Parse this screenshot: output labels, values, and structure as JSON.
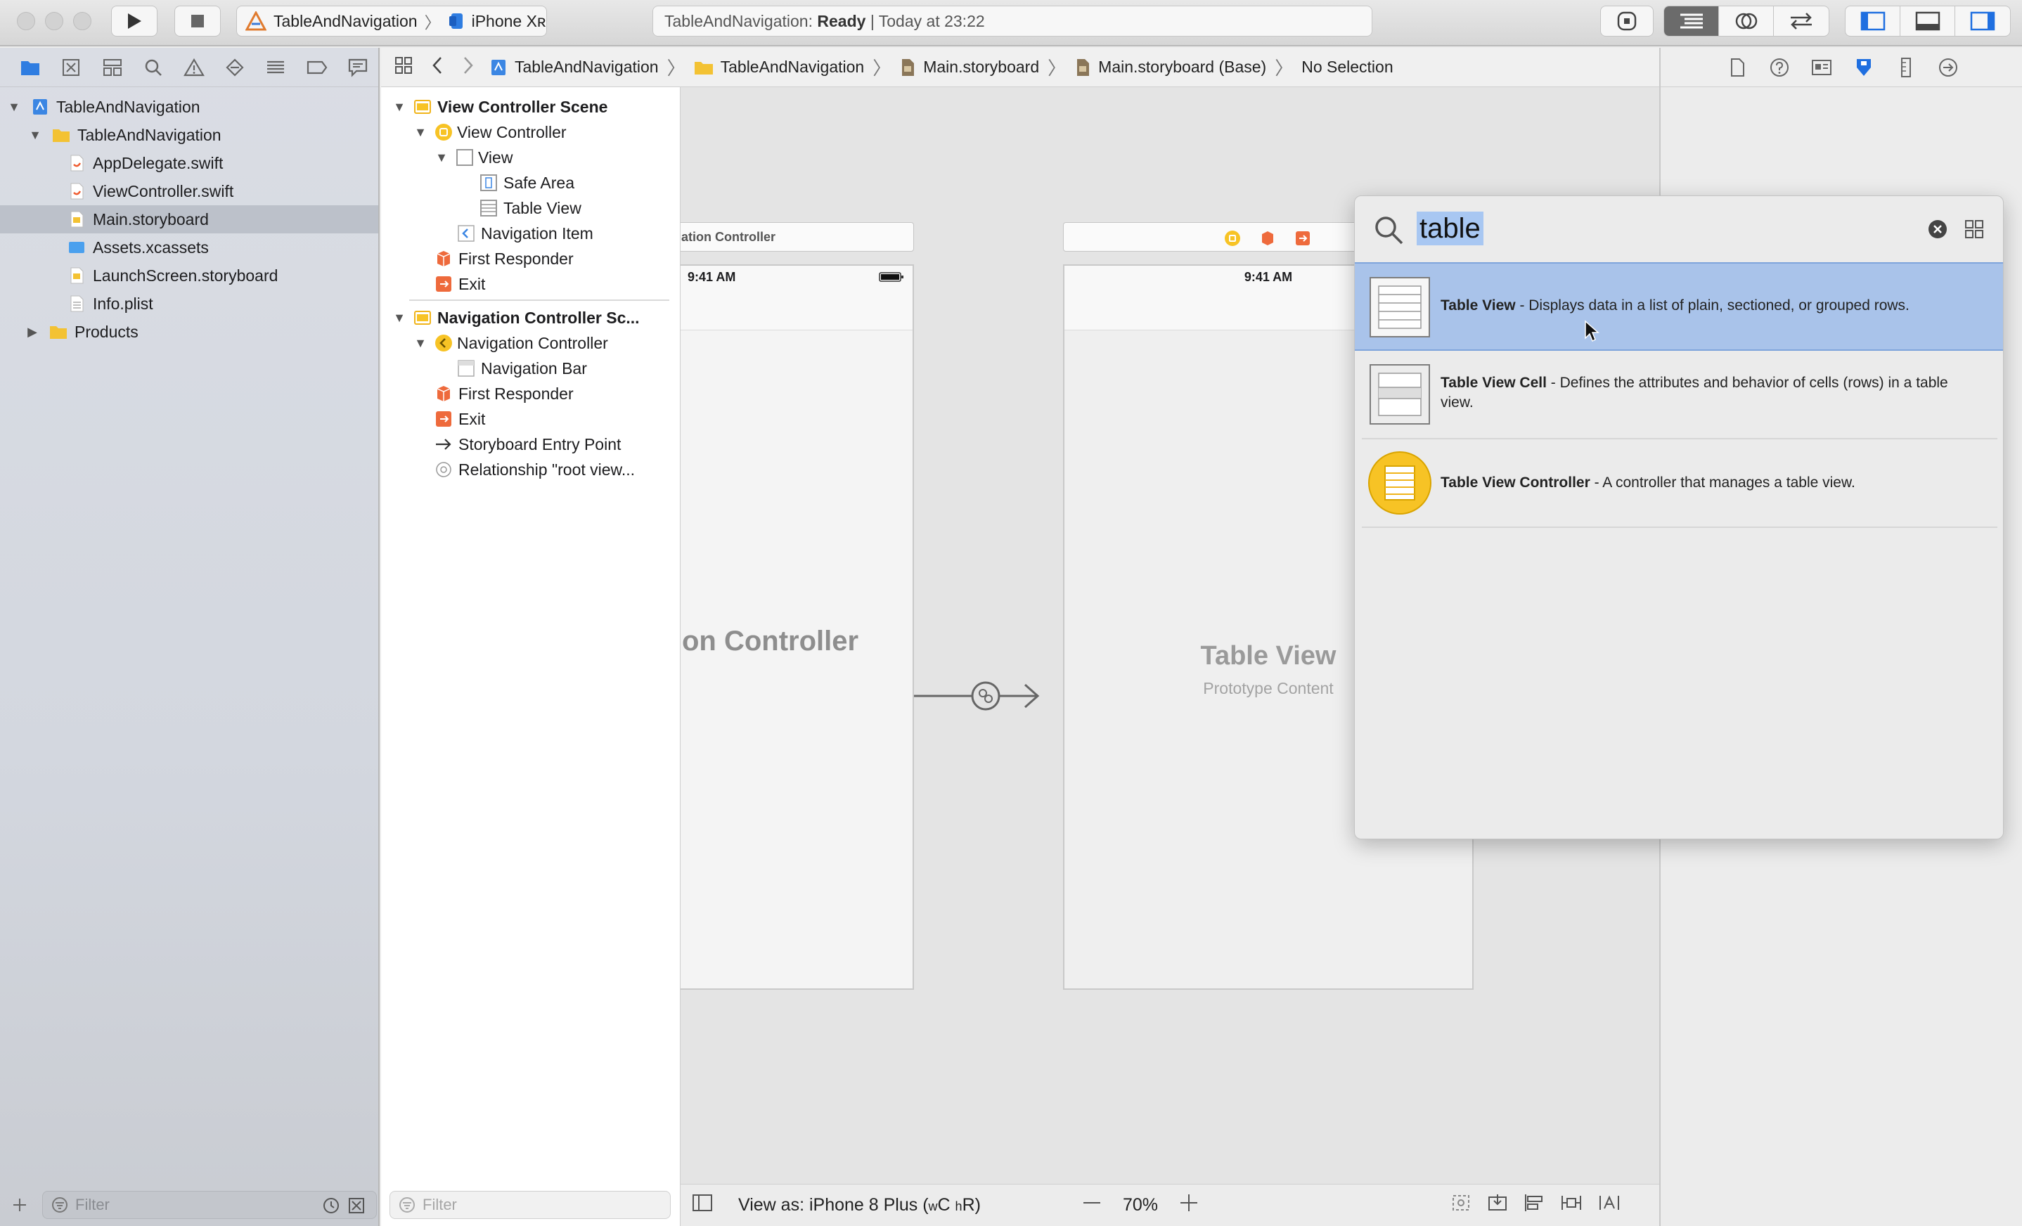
{
  "toolbar": {
    "scheme_target": "TableAndNavigation",
    "scheme_device": "iPhone Xʀ",
    "status_project": "TableAndNavigation:",
    "status_state": "Ready",
    "status_time": "| Today at 23:22"
  },
  "navigator": {
    "items": [
      {
        "label": "TableAndNavigation",
        "level": 0,
        "disclosure": "open",
        "icon": "project-icon"
      },
      {
        "label": "TableAndNavigation",
        "level": 1,
        "disclosure": "open",
        "icon": "folder-icon"
      },
      {
        "label": "AppDelegate.swift",
        "level": 2,
        "icon": "swift-file-icon"
      },
      {
        "label": "ViewController.swift",
        "level": 2,
        "icon": "swift-file-icon"
      },
      {
        "label": "Main.storyboard",
        "level": 2,
        "icon": "storyboard-file-icon",
        "selected": true
      },
      {
        "label": "Assets.xcassets",
        "level": 2,
        "icon": "asset-catalog-icon"
      },
      {
        "label": "LaunchScreen.storyboard",
        "level": 2,
        "icon": "storyboard-file-icon"
      },
      {
        "label": "Info.plist",
        "level": 2,
        "icon": "plist-file-icon"
      },
      {
        "label": "Products",
        "level": 0,
        "disclosure": "closed",
        "icon": "folder-icon"
      }
    ],
    "filter_placeholder": "Filter"
  },
  "jumpbar": {
    "crumbs": [
      "TableAndNavigation",
      "TableAndNavigation",
      "Main.storyboard",
      "Main.storyboard (Base)",
      "No Selection"
    ]
  },
  "outline": {
    "scene1_title": "View Controller Scene",
    "scene1_items": [
      "View Controller",
      "View",
      "Safe Area",
      "Table View",
      "Navigation Item",
      "First Responder",
      "Exit"
    ],
    "scene2_title": "Navigation Controller Sc...",
    "scene2_items": [
      "Navigation Controller",
      "Navigation Bar",
      "First Responder",
      "Exit",
      "Storyboard Entry Point",
      "Relationship \"root view..."
    ],
    "filter_placeholder": "Filter"
  },
  "canvas": {
    "nav_scene_title": "ation Controller",
    "nav_status_time": "9:41 AM",
    "nav_body_label": "on Controller",
    "vc_status_time": "9:41 AM",
    "vc_body_title": "Table View",
    "vc_body_subtitle": "Prototype Content"
  },
  "bottom_bar": {
    "view_as": "View as: iPhone 8 Plus",
    "size_class_open": "(",
    "size_class_w": "w",
    "size_class_c": "C",
    "size_class_h": "h",
    "size_class_r": "R",
    "size_class_close": ")",
    "zoom": "70%"
  },
  "library": {
    "query": "table",
    "results": [
      {
        "name": "Table View",
        "description": " - Displays data in a list of plain, sectioned, or grouped rows.",
        "selected": true
      },
      {
        "name": "Table View Cell",
        "description": " - Defines the attributes and behavior of cells (rows) in a table view.",
        "selected": false
      },
      {
        "name": "Table View Controller",
        "description": " - A controller that manages a table view.",
        "selected": false
      }
    ]
  },
  "colors": {
    "accent": "#1f6fe0",
    "selection": "#a9c3ea",
    "yellow_object": "#f7c325",
    "orange_object": "#ee6a3c"
  }
}
